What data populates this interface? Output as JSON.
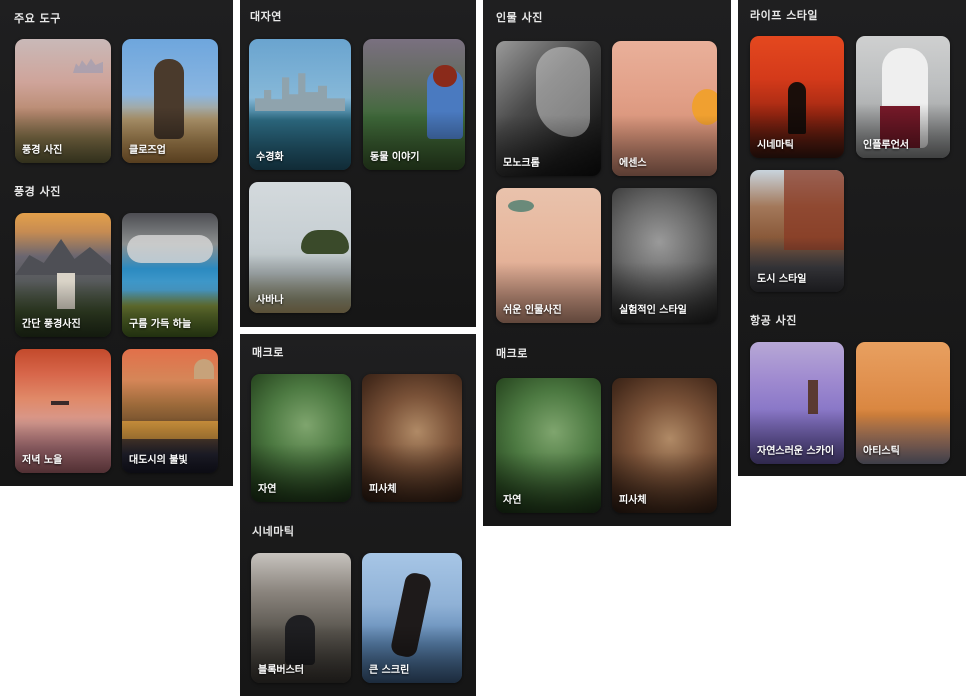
{
  "panel1": {
    "section1_title": "주요 도구",
    "section1_cards": [
      "풍경 사진",
      "클로즈업"
    ],
    "section2_title": "풍경 사진",
    "section2_cards": [
      "간단 풍경사진",
      "구름 가득 하늘",
      "저녁 노을",
      "대도시의 불빛"
    ]
  },
  "panel2": {
    "section1_title": "대자연",
    "section1_cards": [
      "수경화",
      "동물 이야기",
      "사바나"
    ]
  },
  "panel3": {
    "section1_title": "매크로",
    "section1_cards": [
      "자연",
      "피사체"
    ],
    "section2_title": "시네마틱",
    "section2_cards": [
      "블록버스터",
      "큰 스크린"
    ]
  },
  "panel4": {
    "section1_title": "인물 사진",
    "section1_cards": [
      "모노크롬",
      "에센스",
      "쉬운 인물사진",
      "실험적인 스타일"
    ],
    "section2_title": "매크로",
    "section2_cards": [
      "자연",
      "피사체"
    ]
  },
  "panel5": {
    "section1_title": "라이프 스타일",
    "section1_cards": [
      "시네마틱",
      "인플루언서",
      "도시 스타일"
    ],
    "section2_title": "항공 사진",
    "section2_cards": [
      "자연스러운 스카이",
      "아티스틱"
    ]
  }
}
